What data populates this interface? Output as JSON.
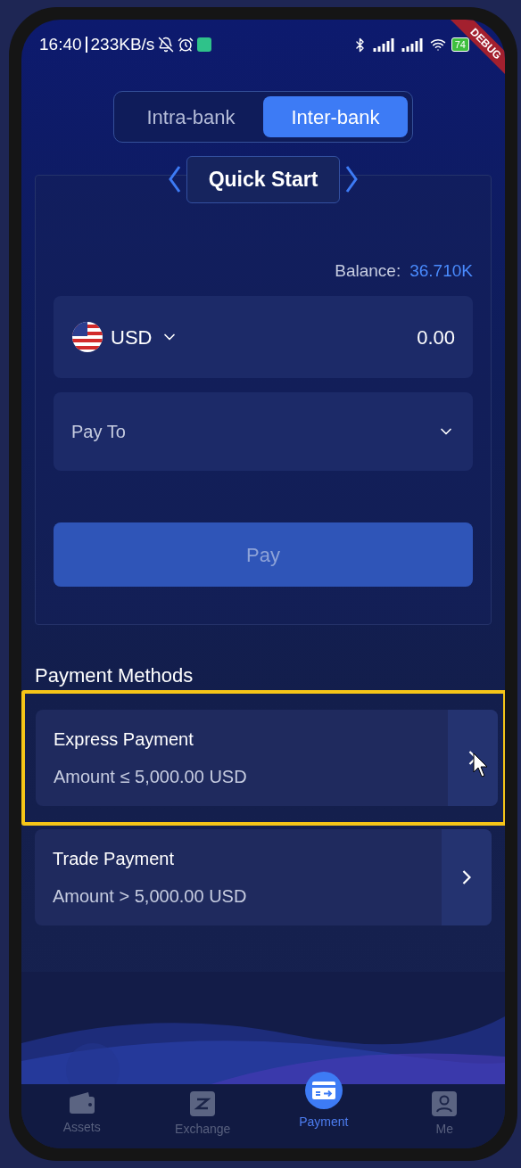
{
  "status_bar": {
    "time": "16:40",
    "speed": "233KB/s",
    "battery": "74",
    "badge": "DEBUG"
  },
  "tabs": [
    {
      "label": "Intra-bank",
      "selected": false
    },
    {
      "label": "Inter-bank",
      "selected": true
    }
  ],
  "header": {
    "title": "Quick Start"
  },
  "balance": {
    "label": "Balance:",
    "value": "36.710K"
  },
  "amount_field": {
    "currency": "USD",
    "value": "0.00"
  },
  "pay_to": {
    "placeholder": "Pay To"
  },
  "pay_button": {
    "label": "Pay",
    "disabled": true
  },
  "section_title": "Payment Methods",
  "methods": [
    {
      "title": "Express Payment",
      "subtitle": "Amount ≤ 5,000.00 USD",
      "highlighted": true
    },
    {
      "title": "Trade Payment",
      "subtitle": "Amount > 5,000.00 USD",
      "highlighted": false
    }
  ],
  "nav": [
    {
      "label": "Assets",
      "kind": "wallet",
      "selected": false
    },
    {
      "label": "Exchange",
      "kind": "exchange",
      "selected": false
    },
    {
      "label": "Payment",
      "kind": "payment",
      "selected": true
    },
    {
      "label": "Me",
      "kind": "person",
      "selected": false
    }
  ]
}
